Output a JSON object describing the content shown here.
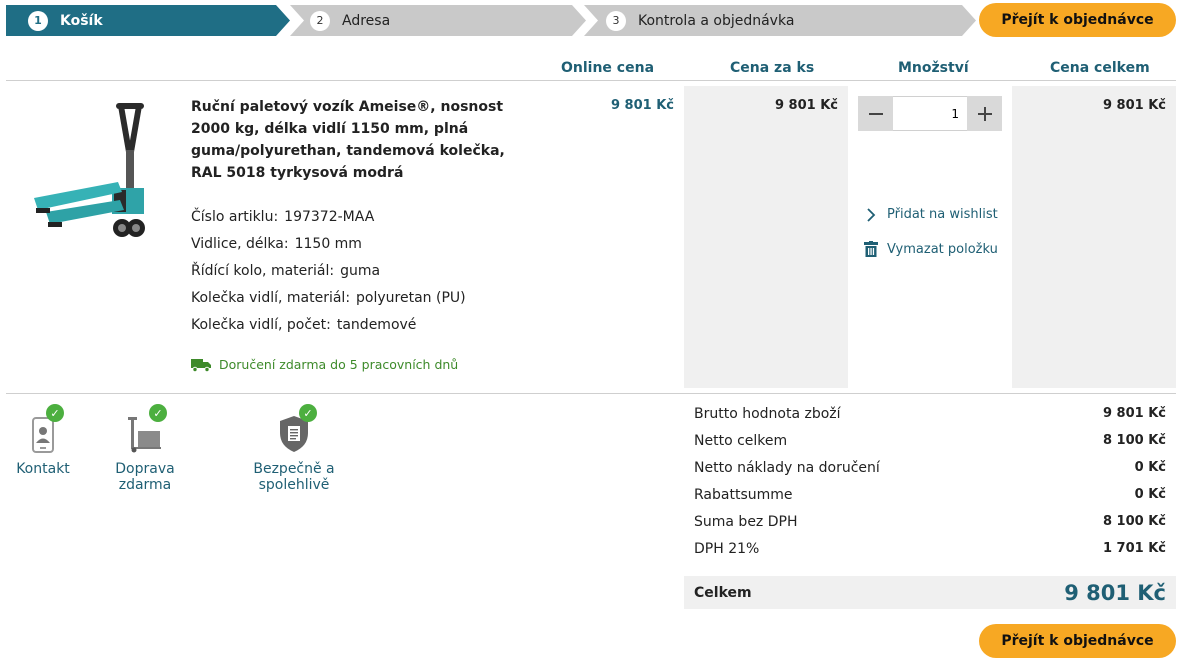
{
  "steps": [
    {
      "num": "1",
      "label": "Košík"
    },
    {
      "num": "2",
      "label": "Adresa"
    },
    {
      "num": "3",
      "label": "Kontrola a objednávka"
    }
  ],
  "cta_label": "Přejít k objednávce",
  "columns": {
    "online_price": "Online cena",
    "unit_price": "Cena za ks",
    "quantity": "Množství",
    "total_price": "Cena celkem"
  },
  "product": {
    "title": "Ruční paletový vozík Ameise®, nosnost 2000 kg, délka vidlí 1150 mm, plná guma/polyurethan, tandemová kolečka, RAL 5018 tyrkysová modrá",
    "attributes": [
      {
        "label": "Číslo artiklu:",
        "value": "197372-MAA"
      },
      {
        "label": "Vidlice, délka:",
        "value": "1150 mm"
      },
      {
        "label": "Řídící kolo, materiál:",
        "value": "guma"
      },
      {
        "label": "Kolečka vidlí, materiál:",
        "value": "polyuretan (PU)"
      },
      {
        "label": "Kolečka vidlí, počet:",
        "value": "tandemové"
      }
    ],
    "delivery": "Doručení zdarma do 5 pracovních dnů",
    "online_price": "9 801 Kč",
    "unit_price": "9 801 Kč",
    "quantity": "1",
    "total_price": "9 801 Kč",
    "wishlist_label": "Přidat na wishlist",
    "delete_label": "Vymazat položku"
  },
  "features": [
    {
      "label": "Kontakt",
      "icon": "phone-contact-icon"
    },
    {
      "label": "Doprava zdarma",
      "icon": "pallet-truck-icon"
    },
    {
      "label": "Bezpečně a spolehlivě",
      "icon": "shield-document-icon"
    }
  ],
  "summary": [
    {
      "label": "Brutto hodnota zboží",
      "value": "9 801 Kč"
    },
    {
      "label": "Netto celkem",
      "value": "8 100 Kč"
    },
    {
      "label": "Netto náklady na doručení",
      "value": "0 Kč"
    },
    {
      "label": "Rabattsumme",
      "value": "0 Kč"
    },
    {
      "label": "Suma bez DPH",
      "value": "8 100 Kč"
    },
    {
      "label": "DPH 21%",
      "value": "1 701 Kč"
    }
  ],
  "total": {
    "label": "Celkem",
    "value": "9 801 Kč"
  },
  "colors": {
    "primary": "#1f6e85",
    "accent": "#f7a823",
    "success": "#4caf3f",
    "inactive_step": "#c9c9c9"
  }
}
